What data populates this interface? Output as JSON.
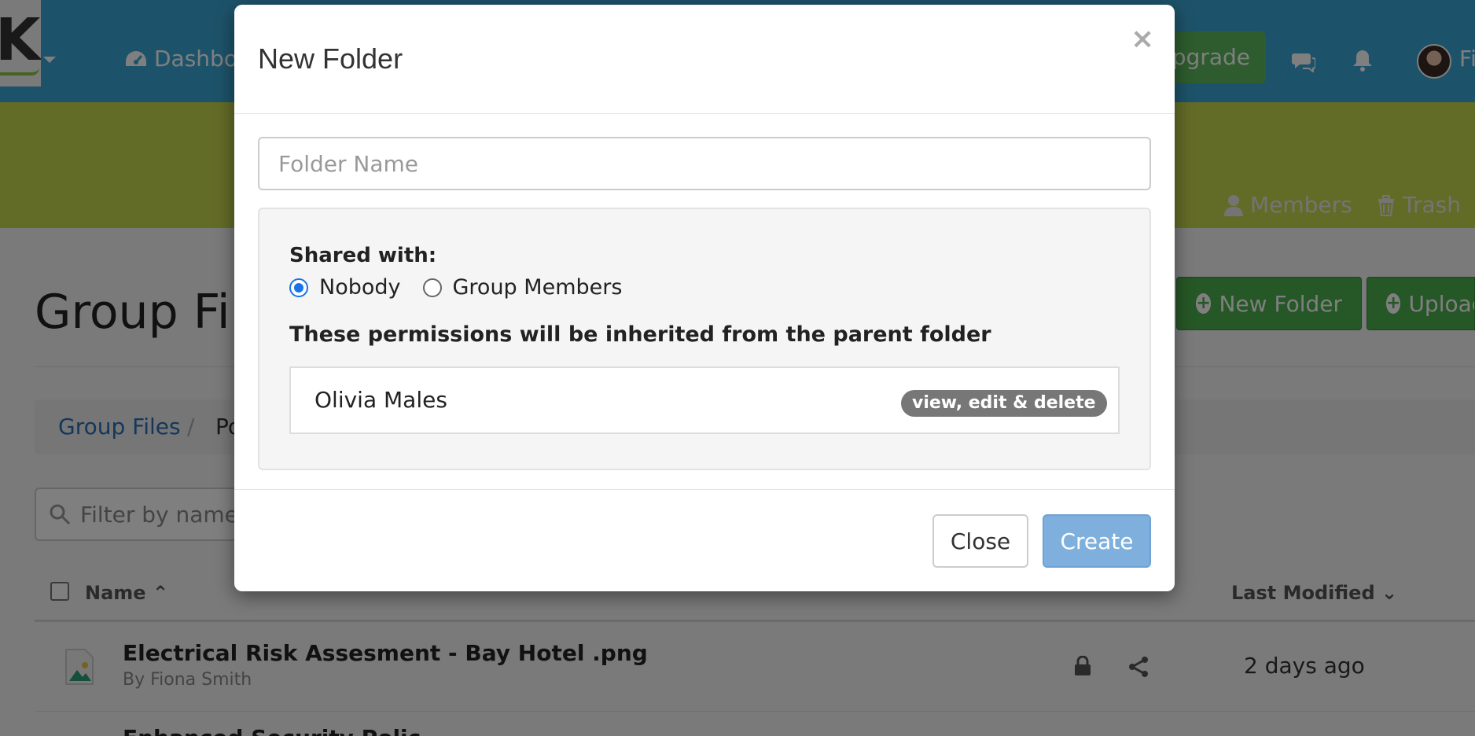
{
  "topnav": {
    "dashboard_label": "Dashboard",
    "upgrade_label": "Upgrade",
    "user_name": "Fiona"
  },
  "group_nav": {
    "members_label": "Members",
    "trash_label": "Trash"
  },
  "page": {
    "title": "Group Files",
    "new_folder_label": "New Folder",
    "upload_label": "Upload",
    "breadcrumb": [
      "Group Files",
      "Po"
    ],
    "filter_placeholder": "Filter by name",
    "columns": {
      "name": "Name",
      "last_modified": "Last Modified"
    },
    "files": [
      {
        "name": "Electrical Risk Assesment - Bay Hotel .png",
        "by": "By  Fiona Smith",
        "modified": "2 days ago"
      },
      {
        "name": "Enhanced Security Policies"
      }
    ]
  },
  "modal": {
    "title": "New Folder",
    "close_symbol": "×",
    "folder_name_placeholder": "Folder Name",
    "shared_with_label": "Shared with:",
    "options": [
      "Nobody",
      "Group Members"
    ],
    "selected_option": "Nobody",
    "inherit_note": "These permissions will be inherited from the parent folder",
    "permissions": [
      {
        "user": "Olivia Males",
        "level": "view, edit & delete"
      }
    ],
    "close_button": "Close",
    "create_button": "Create"
  },
  "colors": {
    "nav": "#3aa7d4",
    "band": "#c6d84f",
    "green_button": "#4cae4c",
    "create_button": "#7fb0dd",
    "radio_selected": "#1a73e8"
  }
}
